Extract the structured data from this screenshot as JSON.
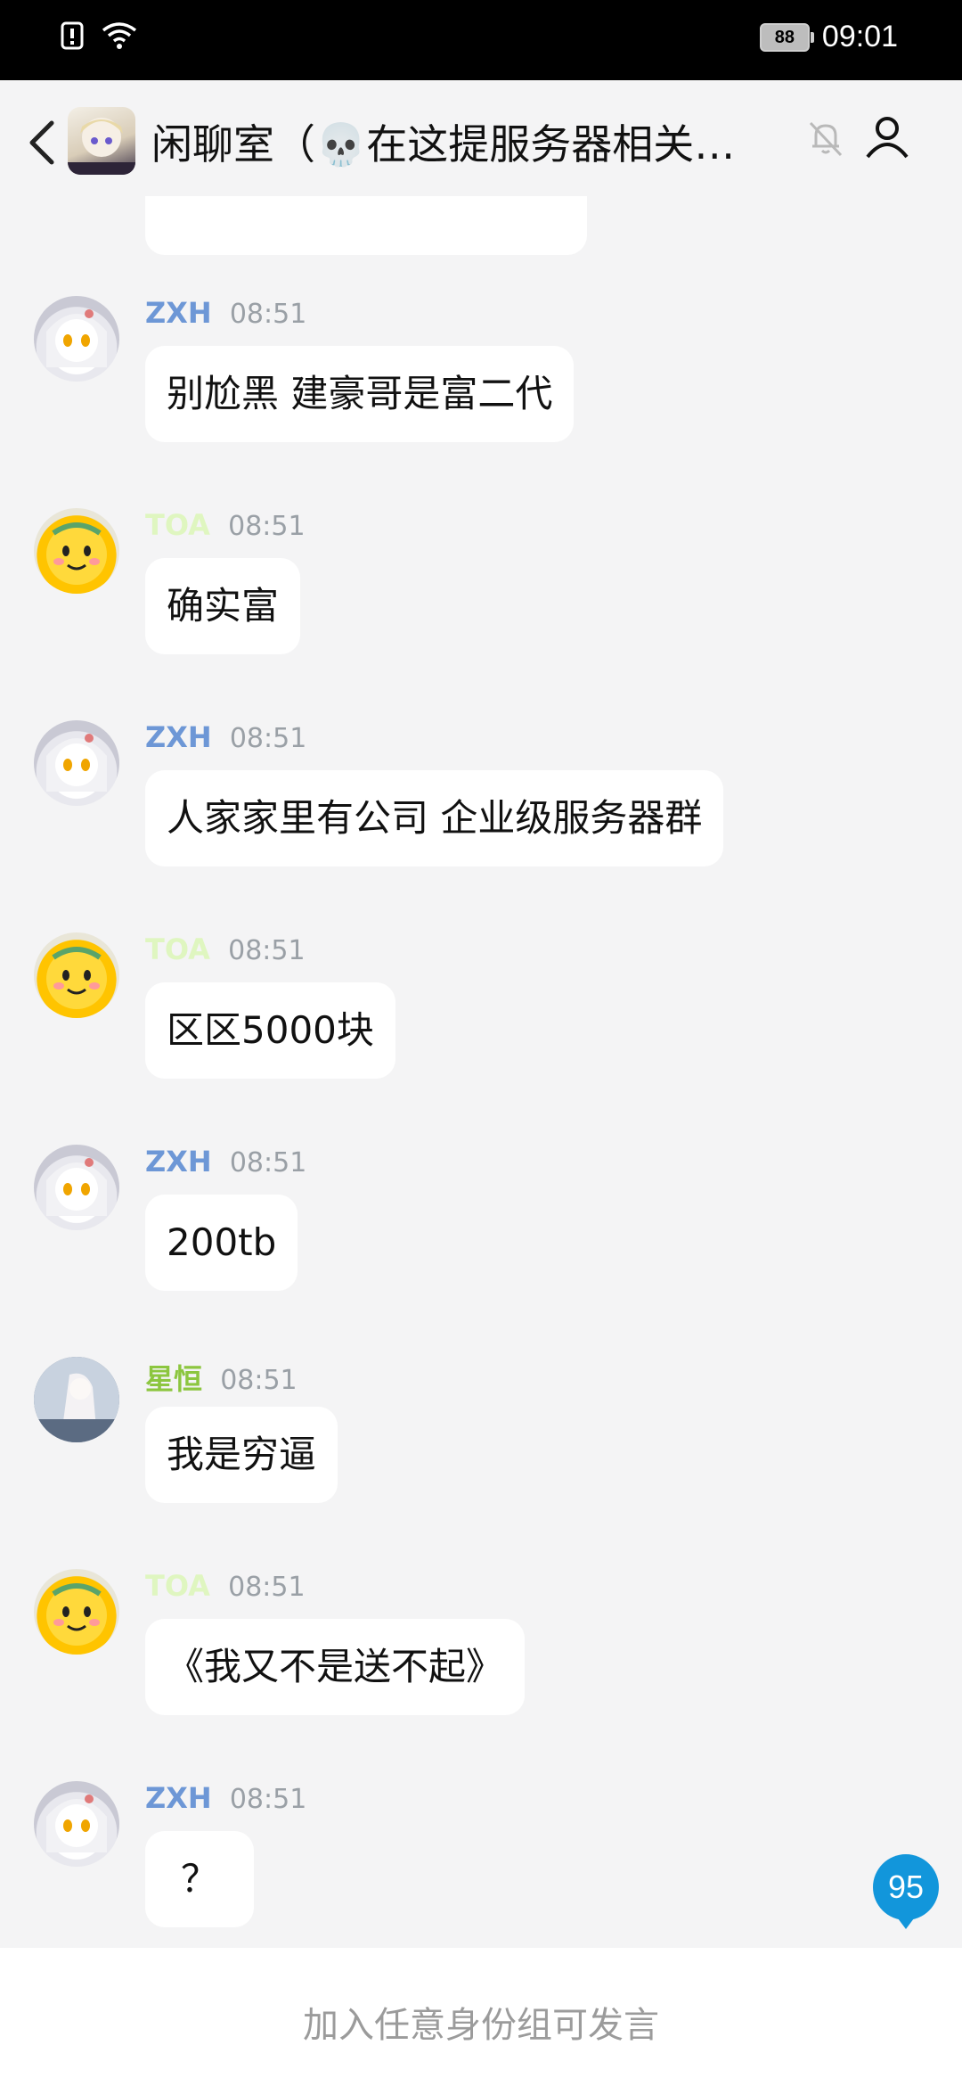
{
  "status_bar": {
    "icons": [
      "sim-alert-icon",
      "wifi-icon"
    ],
    "battery": "88",
    "time": "09:01"
  },
  "header": {
    "back_icon": "chevron-left-icon",
    "title": "闲聊室（💀在这提服务器相关问题）",
    "mute_icon": "bell-off-icon",
    "profile_icon": "person-icon"
  },
  "messages": [
    {
      "name": "ZXH",
      "time": "08:51",
      "text": "别尬黑 建豪哥是富二代"
    },
    {
      "name": "TOA",
      "time": "08:51",
      "text": "确实富"
    },
    {
      "name": "ZXH",
      "time": "08:51",
      "text": "人家家里有公司 企业级服务器群"
    },
    {
      "name": "TOA",
      "time": "08:51",
      "text": "区区5000块"
    },
    {
      "name": "ZXH",
      "time": "08:51",
      "text": "200tb"
    },
    {
      "name": "星恒",
      "time": "08:51",
      "text": "我是穷逼"
    },
    {
      "name": "TOA",
      "time": "08:51",
      "text": "《我又不是送不起》"
    },
    {
      "name": "ZXH",
      "time": "08:51",
      "text": "？"
    }
  ],
  "unread_badge": "95",
  "footer": {
    "placeholder": "加入任意身份组可发言"
  },
  "colors": {
    "name_zxh": "#6d97d6",
    "name_light": "#dff6c0",
    "name_xingheng": "#8cc63f",
    "badge": "#1296db"
  }
}
